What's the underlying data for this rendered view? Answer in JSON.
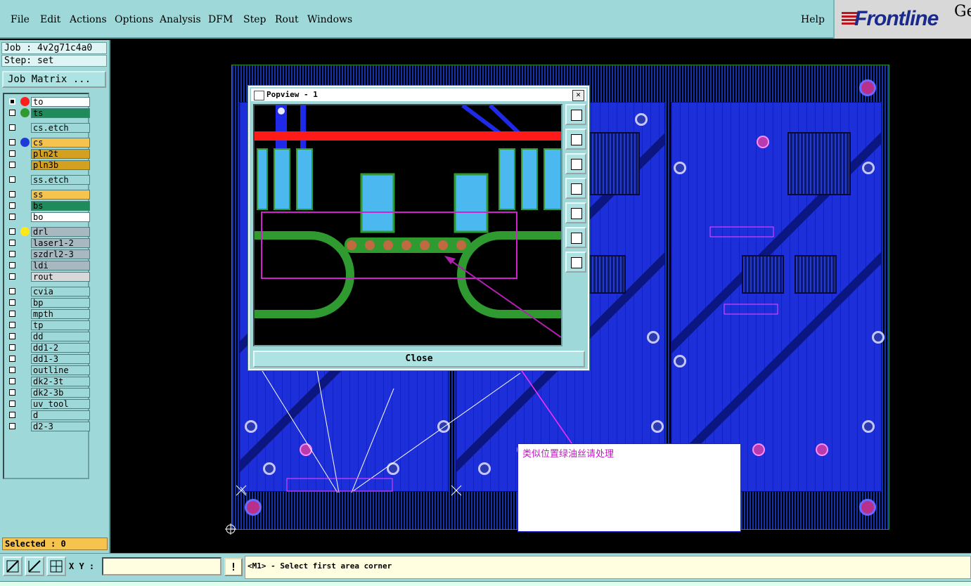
{
  "menu": {
    "items": [
      "File",
      "Edit",
      "Actions",
      "Options",
      "Analysis",
      "DFM",
      "Step",
      "Rout",
      "Windows"
    ],
    "help": "Help"
  },
  "brand": {
    "logo": "Frontline",
    "extra": "Ge"
  },
  "job": {
    "label": "Job : 4v2g71c4a0",
    "step": "Step: set",
    "matrix_button": "Job Matrix ..."
  },
  "layers": [
    {
      "name": "to",
      "color": "#ffffff",
      "dot": "#ff1e1e",
      "checked": true
    },
    {
      "name": "ts",
      "color": "#1f8a5a",
      "dot": "#2f9a2f",
      "checked": false
    },
    {
      "name": "cs.etch",
      "color": "#9ed8d8",
      "dot": "",
      "checked": false
    },
    {
      "name": "cs",
      "color": "#f7c34f",
      "dot": "#1e3ad8",
      "checked": false
    },
    {
      "name": "pln2t",
      "color": "#d4a020",
      "dot": "",
      "checked": false
    },
    {
      "name": "pln3b",
      "color": "#d4a020",
      "dot": "",
      "checked": false
    },
    {
      "name": "ss.etch",
      "color": "#9ed8d8",
      "dot": "",
      "checked": false
    },
    {
      "name": "ss",
      "color": "#f7c34f",
      "dot": "",
      "checked": false
    },
    {
      "name": "bs",
      "color": "#1f8a5a",
      "dot": "",
      "checked": false
    },
    {
      "name": "bo",
      "color": "#ffffff",
      "dot": "",
      "checked": false
    },
    {
      "name": "drl",
      "color": "#a8b8c0",
      "dot": "#ffe81a",
      "checked": false
    },
    {
      "name": "laser1-2",
      "color": "#a8b8c0",
      "dot": "",
      "checked": false
    },
    {
      "name": "szdrl2-3",
      "color": "#a8b8c0",
      "dot": "",
      "checked": false
    },
    {
      "name": "ldi",
      "color": "#a8b8c0",
      "dot": "",
      "checked": false
    },
    {
      "name": "rout",
      "color": "#d8d8d8",
      "dot": "",
      "checked": false
    },
    {
      "name": "cvia",
      "color": "#9ed8d8",
      "dot": "",
      "checked": false
    },
    {
      "name": "bp",
      "color": "#9ed8d8",
      "dot": "",
      "checked": false
    },
    {
      "name": "mpth",
      "color": "#9ed8d8",
      "dot": "",
      "checked": false
    },
    {
      "name": "tp",
      "color": "#9ed8d8",
      "dot": "",
      "checked": false
    },
    {
      "name": "dd",
      "color": "#9ed8d8",
      "dot": "",
      "checked": false
    },
    {
      "name": "dd1-2",
      "color": "#9ed8d8",
      "dot": "",
      "checked": false
    },
    {
      "name": "dd1-3",
      "color": "#9ed8d8",
      "dot": "",
      "checked": false
    },
    {
      "name": "outline",
      "color": "#9ed8d8",
      "dot": "",
      "checked": false
    },
    {
      "name": "dk2-3t",
      "color": "#9ed8d8",
      "dot": "",
      "checked": false
    },
    {
      "name": "dk2-3b",
      "color": "#9ed8d8",
      "dot": "",
      "checked": false
    },
    {
      "name": "uv_tool",
      "color": "#9ed8d8",
      "dot": "",
      "checked": false
    },
    {
      "name": "d",
      "color": "#9ed8d8",
      "dot": "",
      "checked": false
    },
    {
      "name": "d2-3",
      "color": "#9ed8d8",
      "dot": "",
      "checked": false
    }
  ],
  "selected": "Selected : 0",
  "status": {
    "xy_label": "X Y :",
    "xy_value": "",
    "prompt": "<M1> - Select first area corner",
    "bang": "!"
  },
  "popview": {
    "title": "Popview - 1",
    "close": "Close",
    "closex": "✕"
  },
  "note": {
    "text": "类似位置绿油丝请处理"
  }
}
